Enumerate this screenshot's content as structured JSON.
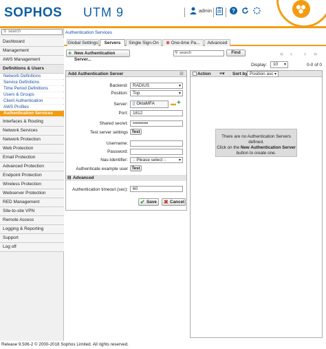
{
  "header": {
    "logo": "SOPHOS",
    "product": "UTM 9",
    "user_label": "admin",
    "icons": [
      "user-icon",
      "clipboard-icon",
      "help-icon",
      "refresh-icon",
      "spinner-icon",
      "shield-badge-icon"
    ]
  },
  "sidebar": {
    "search_placeholder": "search",
    "items": [
      {
        "label": "Dashboard"
      },
      {
        "label": "Management"
      },
      {
        "label": "AWS Management"
      },
      {
        "label": "Definitions & Users"
      },
      {
        "label": "Network Definitions"
      },
      {
        "label": "Service Definitions"
      },
      {
        "label": "Time Period Definitions"
      },
      {
        "label": "Users & Groups"
      },
      {
        "label": "Client Authentication"
      },
      {
        "label": "AWS Profiles"
      },
      {
        "label": "Authentication Services"
      },
      {
        "label": "Interfaces & Routing"
      },
      {
        "label": "Network Services"
      },
      {
        "label": "Network Protection"
      },
      {
        "label": "Web Protection"
      },
      {
        "label": "Email Protection"
      },
      {
        "label": "Advanced Protection"
      },
      {
        "label": "Endpoint Protection"
      },
      {
        "label": "Wireless Protection"
      },
      {
        "label": "Webserver Protection"
      },
      {
        "label": "RED Management"
      },
      {
        "label": "Site-to-site VPN"
      },
      {
        "label": "Remote Access"
      },
      {
        "label": "Logging & Reporting"
      },
      {
        "label": "Support"
      },
      {
        "label": "Log off"
      }
    ]
  },
  "main": {
    "breadcrumb": "Authentication Services",
    "tabs": [
      {
        "label": "Global Settings"
      },
      {
        "label": "Servers"
      },
      {
        "label": "Single Sign-On"
      },
      {
        "label": "One-time Pa..."
      },
      {
        "label": "Advanced"
      }
    ],
    "new_button": "New Authentication Server...",
    "search_placeholder": "search",
    "find_button": "Find",
    "display_label": "Display:",
    "display_value": "10",
    "count": "0-0 of 0"
  },
  "form": {
    "title": "Add Authentication Server",
    "backend_label": "Backend:",
    "backend_value": "RADIUS",
    "position_label": "Position:",
    "position_value": "Top",
    "server_label": "Server:",
    "server_value": "OktaMFA",
    "port_label": "Port:",
    "port_value": "1812",
    "secret_label": "Shared secret:",
    "secret_value": "••••••••••",
    "test_settings_label": "Test server settings",
    "test_button": "Test",
    "username_label": "Username:",
    "password_label": "Password:",
    "nas_label": "Nas-Identifier:",
    "nas_value": ":: Please select ::",
    "auth_example_label": "Authenticate example user",
    "test_button_2": "Test",
    "advanced_label": "Advanced",
    "timeout_label": "Authentication timeout (sec):",
    "timeout_value": "60",
    "save_button": "Save",
    "cancel_button": "Cancel"
  },
  "list": {
    "action_label": "Action",
    "sortby_label": "Sort by:",
    "sortby_value": "Position asc",
    "empty_line1": "There are no Authentication Servers",
    "empty_line2": "defined.",
    "empty_line3": "Click on the",
    "empty_bold": "New Authentication Server",
    "empty_line4": "button to create one."
  },
  "footer": {
    "text": "Release 9.506-2 © 2000-2018 Sophos Limited. All rights reserved."
  },
  "colors": {
    "brand_blue": "#0d5fa5",
    "accent_orange": "#f39c12",
    "link_blue": "#1a4fa0"
  }
}
